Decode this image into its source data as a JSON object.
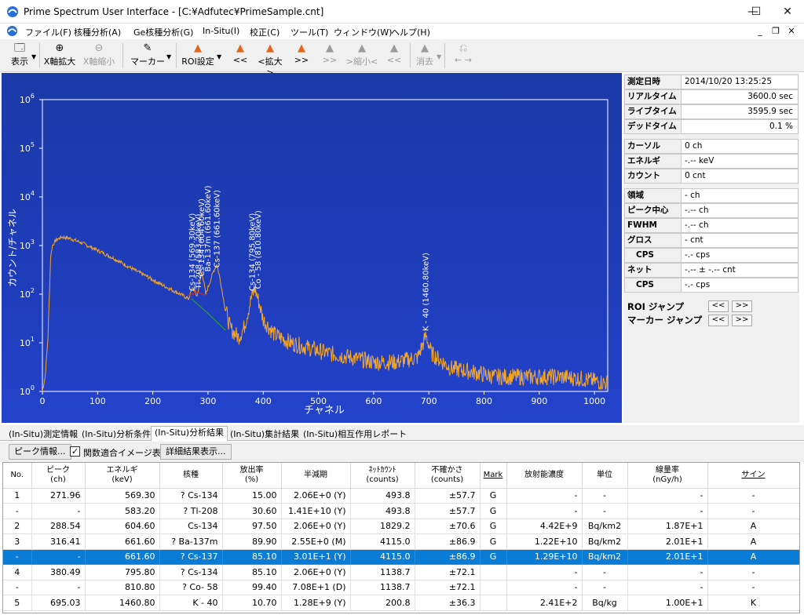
{
  "window": {
    "title": "Prime Spectrum User Interface - [C:¥Adfutec¥PrimeSample.cnt]",
    "minimize": "—",
    "maximize": "☐",
    "close": "✕"
  },
  "menu": {
    "items": [
      "ファイル(F)",
      "核種分析(A)",
      "Ge核種分析(G)",
      "In-Situ(I)",
      "校正(C)",
      "ツール(T)",
      "ウィンドウ(W)",
      "ヘルプ(H)"
    ],
    "mdi_min": "_",
    "mdi_restore": "❐",
    "mdi_close": "✕"
  },
  "toolbar": {
    "display": "表示",
    "x_zoom_in": "X軸拡大",
    "x_zoom_out": "X軸縮小",
    "marker": "マーカー",
    "roi_settings": "ROI設定",
    "prev_far": "<<",
    "zoom": "<拡大>",
    "next_far": ">>",
    "shrink_next": ">>",
    "shrink": ">縮小<",
    "shrink_prev": "<<",
    "erase": "消去",
    "arrows": "← →"
  },
  "chart_data": {
    "type": "line",
    "xlabel": "チャネル",
    "ylabel": "カウント/チャネル",
    "xlim": [
      0,
      1024
    ],
    "ylim_log10": [
      0,
      6
    ],
    "x_ticks": [
      "0",
      "100",
      "200",
      "300",
      "400",
      "500",
      "600",
      "700",
      "800",
      "900",
      "1000"
    ],
    "y_ticks": [
      "10",
      "10",
      "10",
      "10",
      "10",
      "10",
      "10"
    ],
    "y_tick_exponents": [
      "0",
      "1",
      "2",
      "3",
      "4",
      "5",
      "6"
    ],
    "scale": "log",
    "color": "#f5a623",
    "fit_colors": [
      "#d42a2a",
      "#2aa02a"
    ],
    "spectrum": [
      [
        0,
        1
      ],
      [
        5,
        2
      ],
      [
        10,
        12
      ],
      [
        13,
        120
      ],
      [
        15,
        600
      ],
      [
        18,
        1000
      ],
      [
        25,
        1300
      ],
      [
        35,
        1500
      ],
      [
        50,
        1400
      ],
      [
        70,
        1150
      ],
      [
        90,
        900
      ],
      [
        110,
        700
      ],
      [
        130,
        540
      ],
      [
        150,
        400
      ],
      [
        170,
        300
      ],
      [
        190,
        230
      ],
      [
        210,
        170
      ],
      [
        230,
        130
      ],
      [
        250,
        100
      ],
      [
        265,
        80
      ],
      [
        272,
        140
      ],
      [
        280,
        90
      ],
      [
        289,
        300
      ],
      [
        296,
        100
      ],
      [
        310,
        300
      ],
      [
        316,
        420
      ],
      [
        322,
        200
      ],
      [
        330,
        60
      ],
      [
        340,
        20
      ],
      [
        355,
        13
      ],
      [
        365,
        20
      ],
      [
        378,
        80
      ],
      [
        385,
        130
      ],
      [
        392,
        70
      ],
      [
        400,
        30
      ],
      [
        420,
        15
      ],
      [
        450,
        10
      ],
      [
        480,
        8
      ],
      [
        520,
        6
      ],
      [
        560,
        5
      ],
      [
        600,
        4
      ],
      [
        640,
        4
      ],
      [
        680,
        5
      ],
      [
        695,
        14
      ],
      [
        705,
        6
      ],
      [
        740,
        3
      ],
      [
        780,
        2.5
      ],
      [
        820,
        2
      ],
      [
        860,
        2
      ],
      [
        900,
        2
      ],
      [
        940,
        2
      ],
      [
        980,
        1.8
      ],
      [
        1020,
        1.5
      ]
    ],
    "annotations": [
      {
        "channel": 271.96,
        "label": "Cs-134 (569.30keV)"
      },
      {
        "channel": 283,
        "label": "Tl-208 (583.20keV)"
      },
      {
        "channel": 288.54,
        "label": "Cs-134 (604.60keV)"
      },
      {
        "channel": 300,
        "label": "Ba-137m (661.60keV)"
      },
      {
        "channel": 316.41,
        "label": "Cs-137 (661.60keV)"
      },
      {
        "channel": 380.49,
        "label": "Cs-134 (795.80keV)"
      },
      {
        "channel": 391,
        "label": "Co - 58 (810.80keV)"
      },
      {
        "channel": 695.03,
        "label": "K - 40 (1460.80keV)"
      }
    ]
  },
  "info": {
    "measure_date_label": "測定日時",
    "measure_date": "2014/10/20 13:25:25",
    "real_time_label": "リアルタイム",
    "real_time": "3600.0 sec",
    "live_time_label": "ライブタイム",
    "live_time": "3595.9 sec",
    "dead_time_label": "デッドタイム",
    "dead_time": "0.1 %",
    "cursor_label": "カーソル",
    "cursor": "0 ch",
    "energy_label": "エネルギ",
    "energy": "-.-- keV",
    "count_label": "カウント",
    "count": "0 cnt",
    "region_label": "領域",
    "region": "- ch",
    "peak_center_label": "ピーク中心",
    "peak_center": "-.-- ch",
    "fwhm_label": "FWHM",
    "fwhm": "-.-- ch",
    "gross_label": "グロス",
    "gross": "- cnt",
    "gross_cps_label": "CPS",
    "gross_cps": "-.- cps",
    "net_label": "ネット",
    "net": "-.-- ± -.-- cnt",
    "net_cps_label": "CPS",
    "net_cps": "-.- cps",
    "roi_jump": "ROI ジャンプ",
    "marker_jump": "マーカー ジャンプ",
    "jump_prev": "<<",
    "jump_next": ">>"
  },
  "tabs": [
    "(In-Situ)測定情報",
    "(In-Situ)分析条件",
    "(In-Situ)分析結果",
    "(In-Situ)集計結果",
    "(In-Situ)相互作用レポート"
  ],
  "subbar": {
    "peak_info": "ピーク情報...",
    "fit_image": "関数適合イメージ表示",
    "check": "✓",
    "detail": "詳細結果表示..."
  },
  "table": {
    "headers": [
      "No.",
      "ピーク\n(ch)",
      "エネルギ\n(keV)",
      "核種",
      "放出率\n(%)",
      "半減期",
      "ﾈｯﾄｶｳﾝﾄ\n(counts)",
      "不確かさ\n(counts)",
      "Mark",
      "放射能濃度",
      "単位",
      "線量率\n(nGy/h)",
      "サイン"
    ],
    "rows": [
      [
        "1",
        "271.96",
        "569.30",
        "? Cs-134",
        "15.00",
        "2.06E+0 (Y)",
        "493.8",
        "±57.7",
        "G",
        "-",
        "-",
        "-",
        "-"
      ],
      [
        "-",
        "-",
        "583.20",
        "? Tl-208",
        "30.60",
        "1.41E+10 (Y)",
        "493.8",
        "±57.7",
        "G",
        "-",
        "-",
        "-",
        "-"
      ],
      [
        "2",
        "288.54",
        "604.60",
        "Cs-134",
        "97.50",
        "2.06E+0 (Y)",
        "1829.2",
        "±70.6",
        "G",
        "4.42E+9",
        "Bq/km2",
        "1.87E+1",
        "A"
      ],
      [
        "3",
        "316.41",
        "661.60",
        "? Ba-137m",
        "89.90",
        "2.55E+0 (M)",
        "4115.0",
        "±86.9",
        "G",
        "1.22E+10",
        "Bq/km2",
        "2.01E+1",
        "A"
      ],
      [
        "-",
        "-",
        "661.60",
        "? Cs-137",
        "85.10",
        "3.01E+1 (Y)",
        "4115.0",
        "±86.9",
        "G",
        "1.29E+10",
        "Bq/km2",
        "2.01E+1",
        "A"
      ],
      [
        "4",
        "380.49",
        "795.80",
        "? Cs-134",
        "85.10",
        "2.06E+0 (Y)",
        "1138.7",
        "±72.1",
        "",
        "-",
        "-",
        "-",
        "-"
      ],
      [
        "-",
        "-",
        "810.80",
        "? Co- 58",
        "99.40",
        "7.08E+1 (D)",
        "1138.7",
        "±72.1",
        "",
        "-",
        "-",
        "-",
        "-"
      ],
      [
        "5",
        "695.03",
        "1460.80",
        "K - 40",
        "10.70",
        "1.28E+9 (Y)",
        "200.8",
        "±36.3",
        "",
        "2.41E+2",
        "Bq/kg",
        "1.00E+1",
        "K"
      ]
    ],
    "selected_row": 4
  }
}
